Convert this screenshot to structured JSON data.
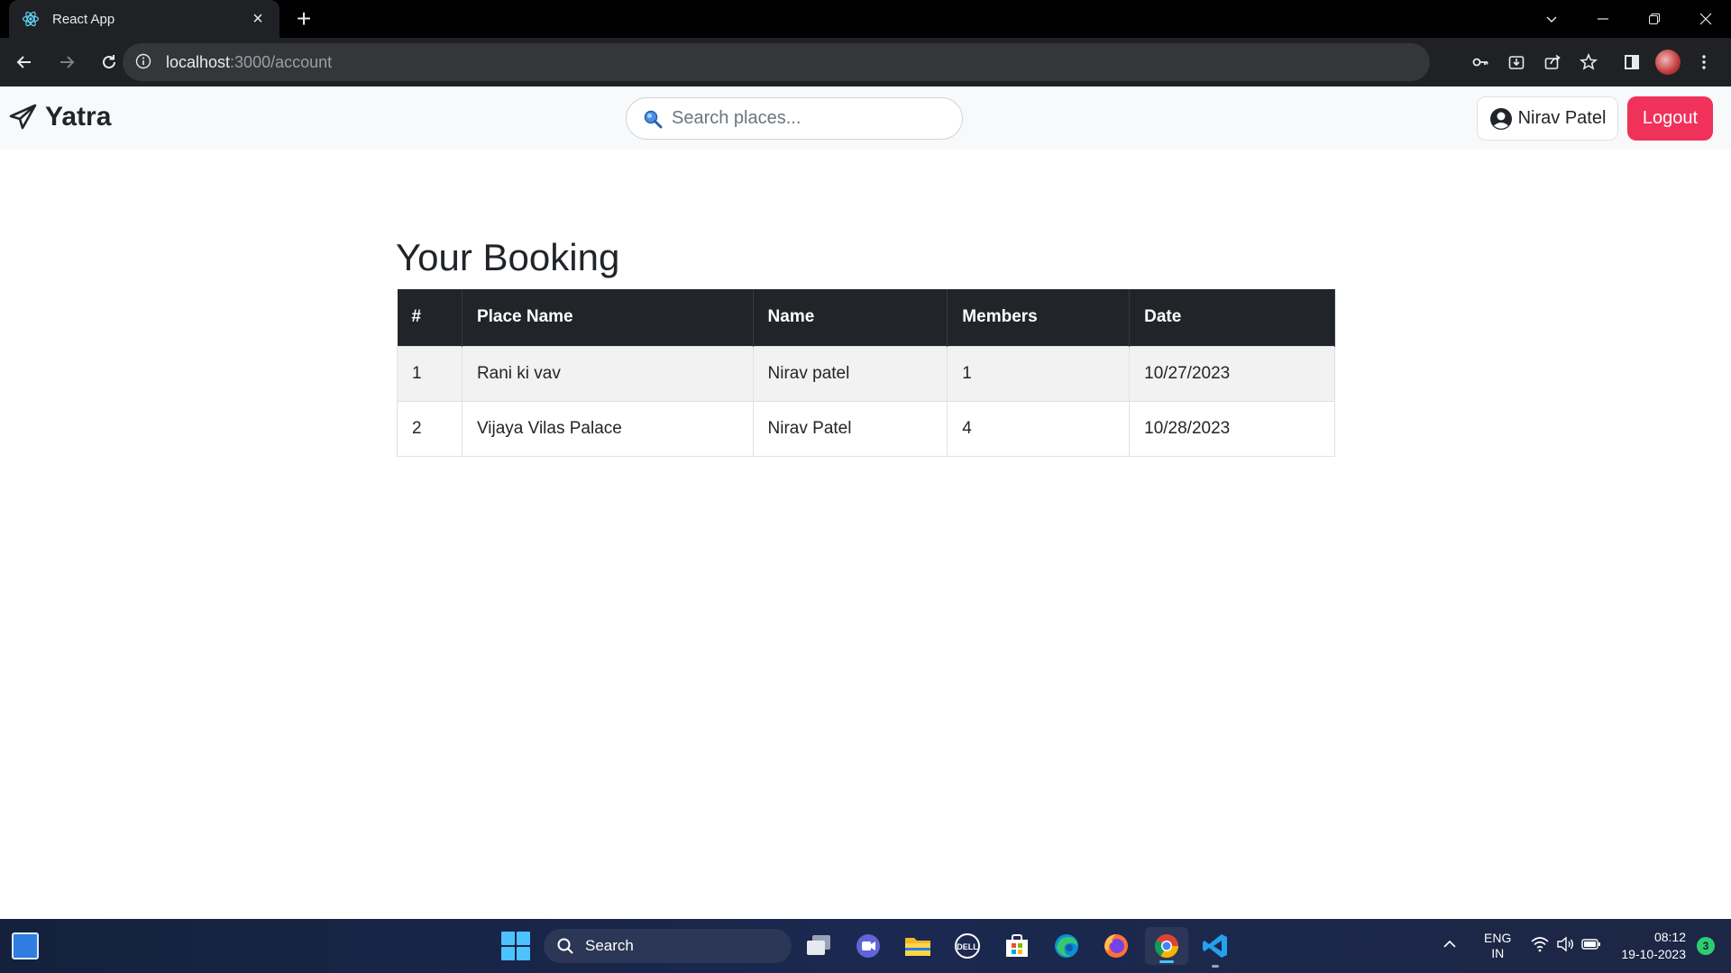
{
  "browser": {
    "tab_title": "React App",
    "url_host": "localhost",
    "url_path": ":3000/account"
  },
  "navbar": {
    "brand": "Yatra",
    "search_placeholder": "Search places...",
    "user_name": "Nirav Patel",
    "logout_label": "Logout"
  },
  "page": {
    "heading": "Your Booking",
    "table": {
      "headers": [
        "#",
        "Place Name",
        "Name",
        "Members",
        "Date"
      ],
      "rows": [
        [
          "1",
          "Rani ki vav",
          "Nirav patel",
          "1",
          "10/27/2023"
        ],
        [
          "2",
          "Vijaya Vilas Palace",
          "Nirav Patel",
          "4",
          "10/28/2023"
        ]
      ]
    }
  },
  "taskbar": {
    "search_label": "Search",
    "lang_line1": "ENG",
    "lang_line2": "IN",
    "time": "08:12",
    "date": "19-10-2023",
    "notification_count": "3"
  },
  "colors": {
    "accent_logout": "#f0325a",
    "table_header": "#212529"
  }
}
